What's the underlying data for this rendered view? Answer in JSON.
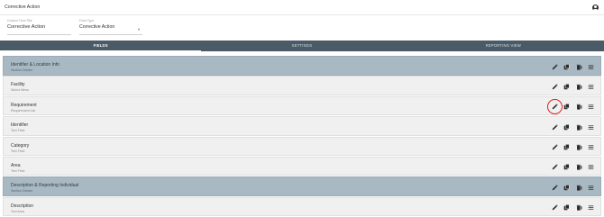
{
  "app": {
    "title": "Corrective Action"
  },
  "form": {
    "name_field": {
      "label": "Custom Form Title",
      "value": "Corrective Action"
    },
    "type_field": {
      "label": "Form Type",
      "value": "Corrective Action"
    }
  },
  "tabs": [
    {
      "label": "FIELDS",
      "active": true
    },
    {
      "label": "SETTINGS",
      "active": false
    },
    {
      "label": "REPORTING VIEW",
      "active": false
    }
  ],
  "rows": [
    {
      "name": "Identifier & Location Info",
      "type": "Section Divider",
      "section": true
    },
    {
      "name": "Facility",
      "type": "Select Menu",
      "section": false
    },
    {
      "name": "Requirement",
      "type": "Requirement List",
      "section": false,
      "highlight": true
    },
    {
      "name": "Identifier",
      "type": "Text Field",
      "section": false
    },
    {
      "name": "Category",
      "type": "Text Field",
      "section": false
    },
    {
      "name": "Area",
      "type": "Text Field",
      "section": false
    },
    {
      "name": "Description & Reporting Individual",
      "type": "Section Divider",
      "section": true
    },
    {
      "name": "Description",
      "type": "Text Area",
      "section": false
    }
  ],
  "icons": {
    "edit": "pencil-icon",
    "copy": "copy-icon",
    "delete": "trash-icon",
    "reorder": "drag-handle-icon",
    "user": "user-icon"
  },
  "colors": {
    "tab_bar": "#4a5a66",
    "section_row": "#a9b9c4",
    "field_row": "#f0f0f0",
    "highlight": "#e02020"
  }
}
